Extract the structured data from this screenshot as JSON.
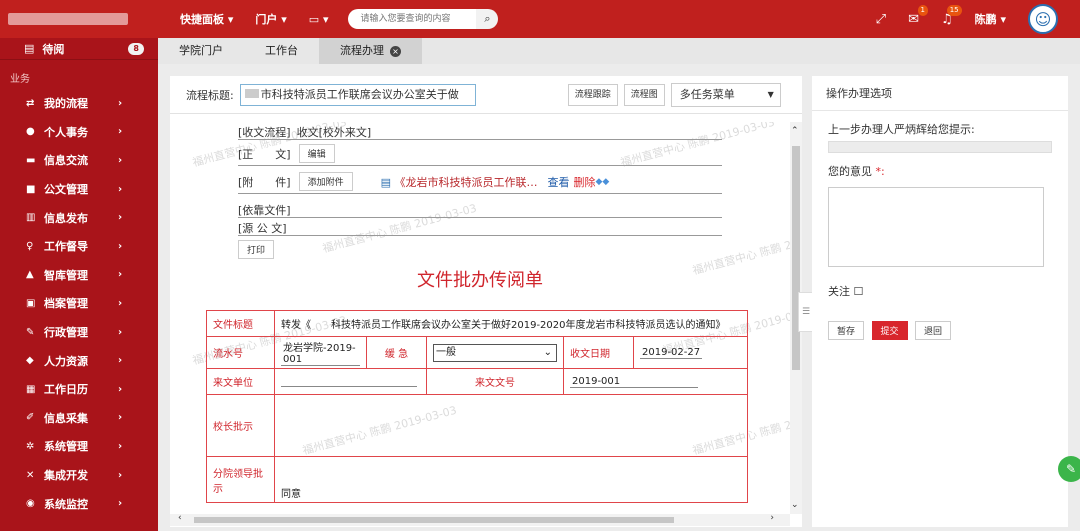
{
  "topbar": {
    "logo_text": "",
    "quick_panel": "快捷面板",
    "portal": "门户",
    "screen_menu": "▭",
    "search_placeholder": "请输入您要查询的内容",
    "badge_notice": "1",
    "badge_bell": "15",
    "user_name": "陈鹏"
  },
  "sidebar": {
    "pending_label": "待阅",
    "pending_count": "8",
    "section": "业务",
    "items": [
      {
        "label": "我的流程",
        "icon": "⇄"
      },
      {
        "label": "个人事务",
        "icon": "●"
      },
      {
        "label": "信息交流",
        "icon": "▬"
      },
      {
        "label": "公文管理",
        "icon": "■"
      },
      {
        "label": "信息发布",
        "icon": "▥"
      },
      {
        "label": "工作督导",
        "icon": "♀"
      },
      {
        "label": "智库管理",
        "icon": "▲"
      },
      {
        "label": "档案管理",
        "icon": "▣"
      },
      {
        "label": "行政管理",
        "icon": "✎"
      },
      {
        "label": "人力资源",
        "icon": "◆"
      },
      {
        "label": "工作日历",
        "icon": "▦"
      },
      {
        "label": "信息采集",
        "icon": "✐"
      },
      {
        "label": "系统管理",
        "icon": "✲"
      },
      {
        "label": "集成开发",
        "icon": "✕"
      },
      {
        "label": "系统监控",
        "icon": "◉"
      }
    ]
  },
  "tabs": {
    "t1": "学院门户",
    "t2": "工作台",
    "t3": "流程办理"
  },
  "flow": {
    "title_label": "流程标题:",
    "title_value": "市科技特派员工作联席会议办公室关于做",
    "btn_trace": "流程跟踪",
    "btn_chart": "流程图",
    "multi_menu": "多任务菜单"
  },
  "doc": {
    "receive_flow": "[收文流程]",
    "receive_type": "收文[校外来文]",
    "zhengwen": "[正　　文]",
    "edit": "编辑",
    "fujian": "[附　　件]",
    "add_attach": "添加附件",
    "attach_name": "《龙岩市科技特派员工作联…",
    "view": "查看",
    "delete": "删除",
    "yikao": "[依靠文件]",
    "yuangongwen": "[源 公 文]",
    "print": "打印",
    "form_title": "文件批办传阅单",
    "watermark": "福州直营中心 陈鹏 2019-03-03"
  },
  "table": {
    "l_title": "文件标题",
    "v_title": "转发《　　科技特派员工作联席会议办公室关于做好2019-2020年度龙岩市科技特派员选认的通知》",
    "l_serial": "流水号",
    "v_serial": "龙岩学院-2019-001",
    "l_urgency": "缓 急",
    "v_urgency": "一般",
    "l_recv_date": "收文日期",
    "v_recv_date": "2019-02-27",
    "l_from": "来文单位",
    "v_from": "",
    "l_docno": "来文文号",
    "v_docno": "2019-001",
    "l_president": "校长批示",
    "v_president": "",
    "l_branch": "分院领导批示",
    "v_branch": "同意"
  },
  "right": {
    "panel_title": "操作办理选项",
    "prev_prompt": "上一步办理人严炳辉给您提示:",
    "opinion": "您的意见",
    "required": "*:",
    "follow": "关注 ☐",
    "btn_save": "暂存",
    "btn_submit": "提交",
    "btn_back": "退回"
  }
}
